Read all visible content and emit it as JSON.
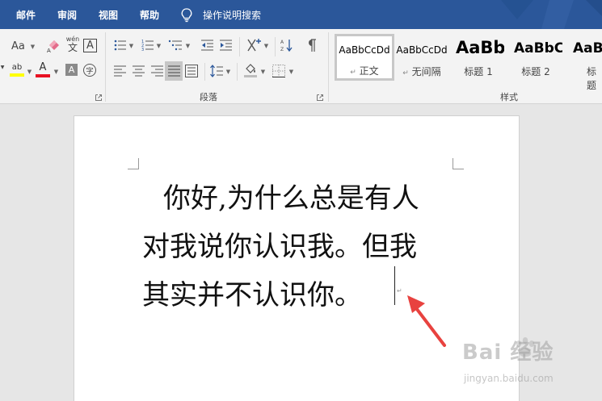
{
  "menubar": {
    "tabs": [
      "邮件",
      "审阅",
      "视图",
      "帮助"
    ],
    "tell_me": "操作说明搜索"
  },
  "ribbon": {
    "font_group": {
      "font_size_menu": "Aa",
      "phonetic_label": "wén",
      "phonetic_char": "文",
      "char_border": "A",
      "highlight_icon_label": "ab",
      "font_color_label": "A",
      "char_shading_label": "A",
      "enclose_char_label": "字"
    },
    "paragraph_group": {
      "label": "段落"
    },
    "styles_group": {
      "label": "样式",
      "styles": [
        {
          "preview": "AaBbCcDd",
          "name": "正文",
          "paragraph_mark": "↵"
        },
        {
          "preview": "AaBbCcDd",
          "name": "无间隔",
          "paragraph_mark": "↵"
        },
        {
          "preview": "AaBb",
          "name": "标题 1"
        },
        {
          "preview": "AaBbC",
          "name": "标题 2"
        },
        {
          "preview": "AaB",
          "name": "标题"
        }
      ]
    }
  },
  "document": {
    "lines": [
      "你好,为什么总是有人",
      "对我说你认识我。但我",
      "其实并不认识你。"
    ],
    "paragraph_mark": "↵"
  },
  "watermark": {
    "logo": "Bai 经验",
    "url": "jingyan.baidu.com"
  },
  "colors": {
    "menubar": "#2b579a",
    "ribbon": "#f3f3f3",
    "highlight": "#ffff00",
    "font_color": "#e81123",
    "arrow": "#e8423f"
  },
  "icons": [
    "lightbulb-icon",
    "eraser-icon",
    "bullets-icon",
    "numbering-icon",
    "multilevel-list-icon",
    "decrease-indent-icon",
    "increase-indent-icon",
    "chinese-layout-icon",
    "sort-icon",
    "show-marks-icon",
    "align-left-icon",
    "center-icon",
    "align-right-icon",
    "justify-icon",
    "distributed-icon",
    "line-spacing-icon",
    "shading-icon",
    "borders-icon",
    "dialog-launcher-icon"
  ]
}
